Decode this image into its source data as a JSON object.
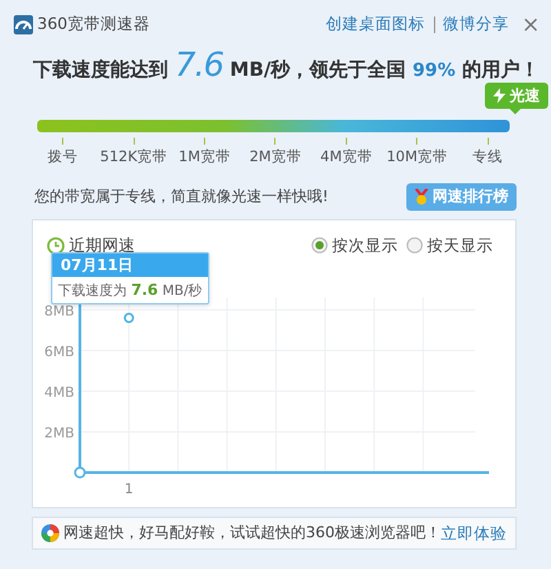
{
  "window": {
    "title": "360宽带测速器",
    "links": [
      "创建桌面图标",
      "微博分享"
    ],
    "close": "×"
  },
  "headline": "下载速度能达到 **7.6** MB/秒，领先于全国 **99%** 的用户！",
  "speed_bar": {
    "badge": "光速",
    "level": 1,
    "tiers": [
      "拨号",
      "512K宽带",
      "1M宽带",
      "2M宽带",
      "4M宽带",
      "10M宽带",
      "专线"
    ]
  },
  "verdict": "您的带宽属于专线，简直就像光速一样快哦!",
  "ranking_button": "网速排行榜",
  "recent": {
    "title": "近期网速",
    "options": [
      {
        "label": "按次显示",
        "selected": true
      },
      {
        "label": "按天显示",
        "selected": false
      }
    ],
    "tooltip": {
      "date": "07月11日",
      "text": "下载速度为 **7.6** MB/秒"
    },
    "chart_data": {
      "type": "line",
      "grid": true,
      "categories": [
        "1"
      ],
      "series": [
        {
          "color": "#4fb3e6",
          "marker": true,
          "values": [
            7.6
          ]
        }
      ],
      "ylim": [
        0,
        8.6
      ],
      "yticks": [
        {
          "value": 2,
          "label": "2MB"
        },
        {
          "value": 4,
          "label": "4MB"
        },
        {
          "value": 6,
          "label": "6MB"
        },
        {
          "value": 8,
          "label": "8MB"
        }
      ]
    }
  },
  "footer": {
    "text": "网速超快，好马配好鞍，试试超快的360极速浏览器吧！",
    "link": "立即体验"
  }
}
